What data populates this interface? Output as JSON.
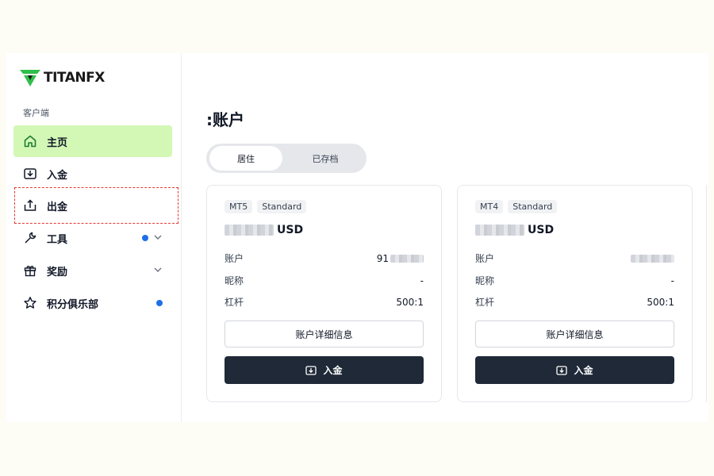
{
  "brand": {
    "name": "TITANFX",
    "green": "#2fbf4a",
    "active_bg": "#d3f8b6"
  },
  "sidebar": {
    "section_label": "客户端",
    "items": [
      {
        "label": "主页",
        "icon": "home-icon",
        "active": true
      },
      {
        "label": "入金",
        "icon": "deposit-icon"
      },
      {
        "label": "出金",
        "icon": "withdraw-icon",
        "highlighted": true
      },
      {
        "label": "工具",
        "icon": "wrench-icon",
        "dot": true,
        "chevron": true
      },
      {
        "label": "奖励",
        "icon": "gift-icon",
        "chevron": true
      },
      {
        "label": "积分俱乐部",
        "icon": "star-icon",
        "dot": true
      }
    ]
  },
  "main": {
    "title": ":账户",
    "tabs": [
      {
        "label": "居住",
        "active": true
      },
      {
        "label": "已存档"
      }
    ],
    "cards": [
      {
        "platform": "MT5",
        "type": "Standard",
        "currency": "USD",
        "rows": [
          {
            "label": "账户",
            "value": "91"
          },
          {
            "label": "昵称",
            "value": "-"
          },
          {
            "label": "杠杆",
            "value": "500:1"
          }
        ],
        "details_label": "账户详细信息",
        "deposit_label": "入金"
      },
      {
        "platform": "MT4",
        "type": "Standard",
        "currency": "USD",
        "rows": [
          {
            "label": "账户",
            "value": ""
          },
          {
            "label": "昵称",
            "value": "-"
          },
          {
            "label": "杠杆",
            "value": "500:1"
          }
        ],
        "details_label": "账户详细信息",
        "deposit_label": "入金"
      }
    ]
  }
}
